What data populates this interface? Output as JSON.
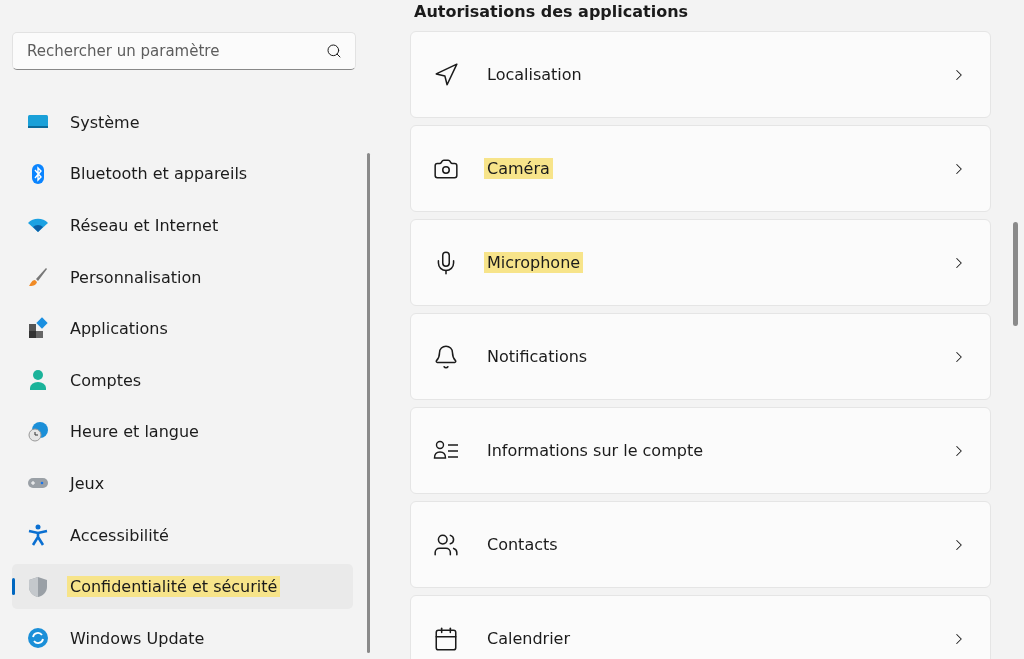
{
  "search": {
    "placeholder": "Rechercher un paramètre"
  },
  "sidebar": {
    "items": [
      {
        "label": "Système",
        "selected": false,
        "highlighted": false
      },
      {
        "label": "Bluetooth et appareils",
        "selected": false,
        "highlighted": false
      },
      {
        "label": "Réseau et Internet",
        "selected": false,
        "highlighted": false
      },
      {
        "label": "Personnalisation",
        "selected": false,
        "highlighted": false
      },
      {
        "label": "Applications",
        "selected": false,
        "highlighted": false
      },
      {
        "label": "Comptes",
        "selected": false,
        "highlighted": false
      },
      {
        "label": "Heure et langue",
        "selected": false,
        "highlighted": false
      },
      {
        "label": "Jeux",
        "selected": false,
        "highlighted": false
      },
      {
        "label": "Accessibilité",
        "selected": false,
        "highlighted": false
      },
      {
        "label": "Confidentialité et sécurité",
        "selected": true,
        "highlighted": true
      },
      {
        "label": "Windows Update",
        "selected": false,
        "highlighted": false
      }
    ]
  },
  "section": {
    "title": "Autorisations des applications",
    "items": [
      {
        "label": "Localisation",
        "highlighted": false
      },
      {
        "label": "Caméra",
        "highlighted": true
      },
      {
        "label": "Microphone",
        "highlighted": true
      },
      {
        "label": "Notifications",
        "highlighted": false
      },
      {
        "label": "Informations sur le compte",
        "highlighted": false
      },
      {
        "label": "Contacts",
        "highlighted": false
      },
      {
        "label": "Calendrier",
        "highlighted": false
      }
    ]
  }
}
